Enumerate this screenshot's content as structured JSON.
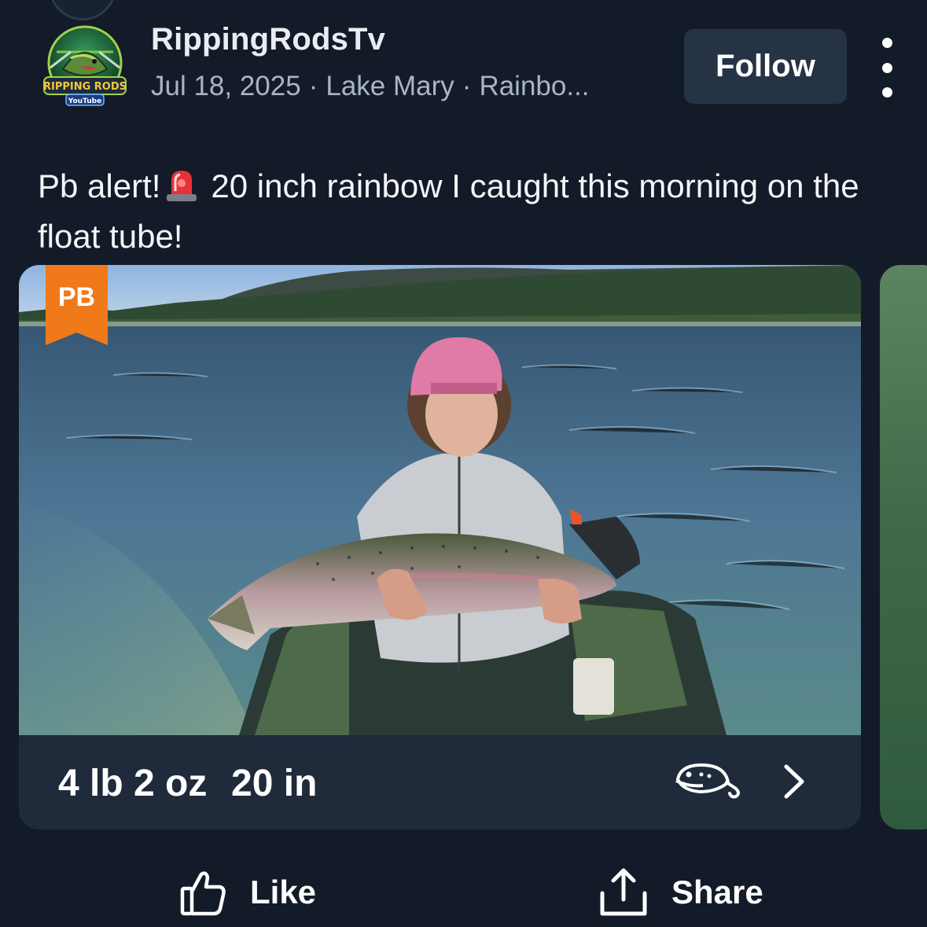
{
  "post": {
    "username": "RippingRodsTv",
    "date": "Jul 18, 2025",
    "separator": "·",
    "location": "Lake Mary",
    "species": "Rainbo...",
    "follow_label": "Follow",
    "caption_part1": "Pb alert!",
    "caption_part2": "20 inch rainbow I caught this morning on the float tube!",
    "avatar": {
      "line1": "RIPPING RODS",
      "line2": "YouTube"
    }
  },
  "catch": {
    "badge": "PB",
    "weight": "4 lb 2 oz",
    "length": "20 in",
    "lure_icon": "lure-icon",
    "next_icon": "chevron-right-icon"
  },
  "actions": {
    "like_label": "Like",
    "share_label": "Share"
  },
  "colors": {
    "background": "#131b28",
    "card": "#1f2b3b",
    "follow_button": "#263345",
    "pb_badge": "#f07a1a",
    "meta_text": "#aab4c2"
  }
}
